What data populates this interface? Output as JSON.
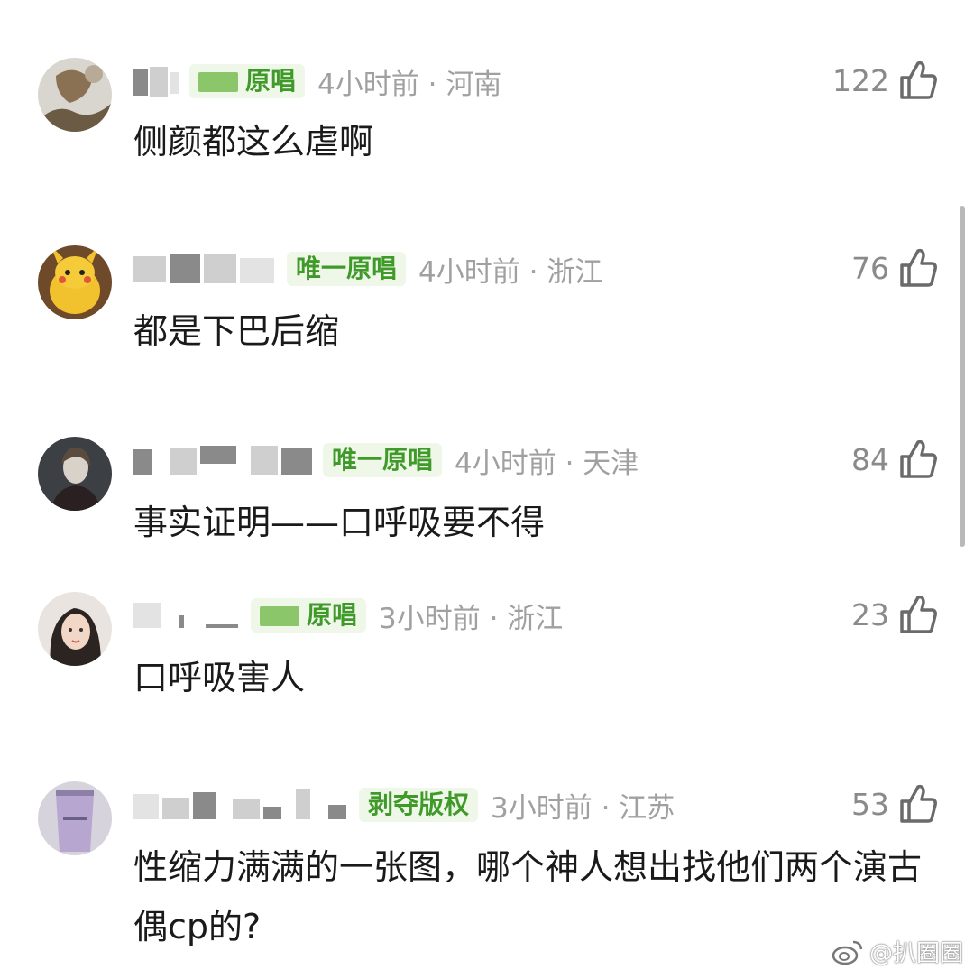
{
  "comments": [
    {
      "badge": "原唱",
      "badge_masked": true,
      "time_location": "4小时前 · 河南",
      "likes": "122",
      "text": "侧颜都这么虐啊"
    },
    {
      "badge": "唯一原唱",
      "badge_masked": false,
      "time_location": "4小时前 · 浙江",
      "likes": "76",
      "text": "都是下巴后缩"
    },
    {
      "badge": "唯一原唱",
      "badge_masked": false,
      "time_location": "4小时前 · 天津",
      "likes": "84",
      "text": "事实证明——口呼吸要不得"
    },
    {
      "badge": "原唱",
      "badge_masked": true,
      "time_location": "3小时前 · 浙江",
      "likes": "23",
      "text": "口呼吸害人"
    },
    {
      "badge": "剥夺版权",
      "badge_masked": false,
      "time_location": "3小时前 · 江苏",
      "likes": "53",
      "text": "性缩力满满的一张图，哪个神人想出找他们两个演古偶cp的?"
    }
  ],
  "watermark": "@扒圈圈",
  "icons": {
    "like": "thumbs-up-icon",
    "watermark": "weibo-logo-icon"
  },
  "colors": {
    "badge_text": "#3f9a2a",
    "badge_bg": "#eef7e8",
    "meta_gray": "#a0a0a0"
  }
}
